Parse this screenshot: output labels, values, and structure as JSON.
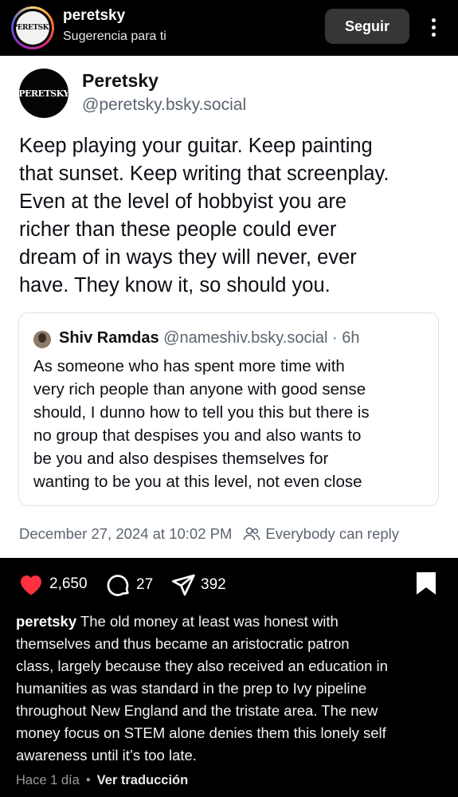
{
  "header": {
    "username": "peretsky",
    "subtitle": "Sugerencia para ti",
    "follow_label": "Seguir",
    "avatar_text": "PERETSKY"
  },
  "post": {
    "display_name": "Peretsky",
    "handle": "@peretsky.bsky.social",
    "text_lines": [
      "Keep playing your guitar. Keep painting",
      "that sunset.  Keep writing that screenplay.",
      "Even at the level of hobbyist you are",
      "richer than these people could ever",
      "dream of in ways they will never, ever",
      "have. They know it, so should you."
    ],
    "quote": {
      "name": "Shiv Ramdas",
      "handle": "@nameshiv.bsky.social",
      "time": "· 6h",
      "text_lines": [
        "As someone who has spent more time with",
        "very rich people than anyone with good sense",
        "should, I dunno how to tell you this but there is",
        "no group that despises you and also wants to",
        "be you and also despises themselves for",
        "wanting to be you at this level, not even close"
      ]
    },
    "date": "December 27, 2024 at 10:02 PM",
    "reply_setting": "Everybody can reply"
  },
  "actions": {
    "likes": "2,650",
    "comments": "27",
    "shares": "392",
    "like_color": "#ff3040"
  },
  "caption": {
    "username": "peretsky",
    "first_line": "The old money at least was honest with",
    "lines": [
      "themselves and thus became an aristocratic patron",
      "class, largely because they also received an education in",
      "humanities as was standard in the prep to Ivy pipeline",
      "throughout New England and the tristate area. The new",
      "money focus on STEM alone denies them this lonely self",
      "awareness until it’s too late."
    ]
  },
  "footer": {
    "time_ago": "Hace 1 día",
    "separator": "•",
    "translate_label": "Ver traducción"
  }
}
